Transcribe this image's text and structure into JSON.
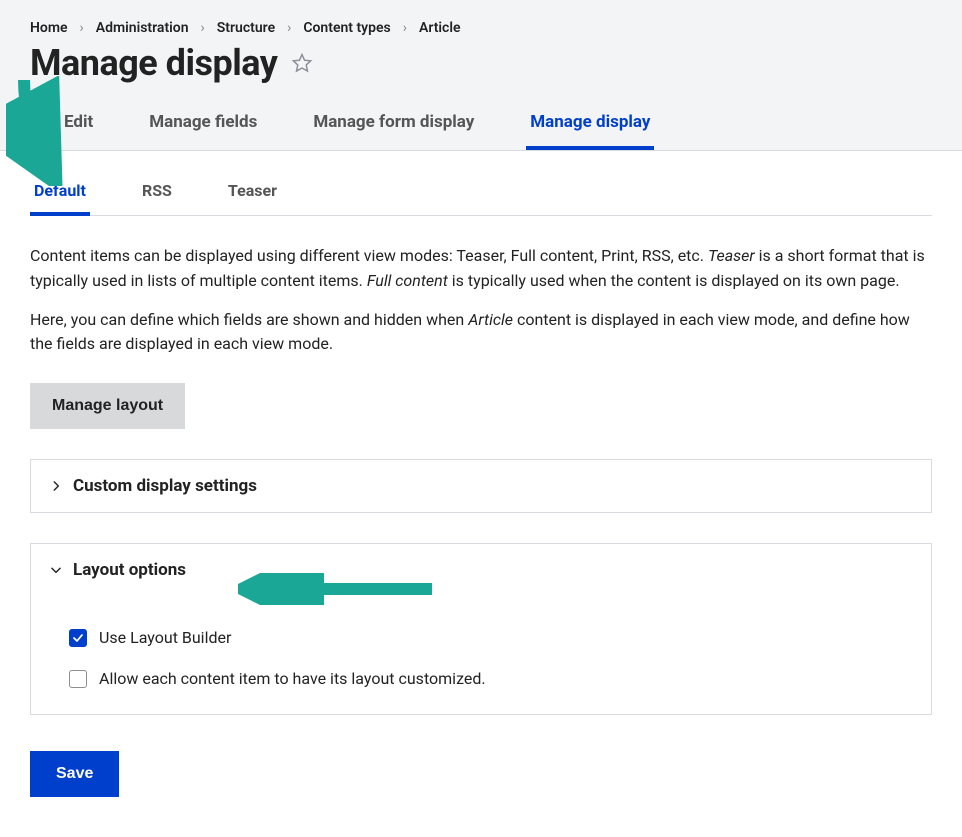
{
  "breadcrumb": [
    "Home",
    "Administration",
    "Structure",
    "Content types",
    "Article"
  ],
  "page_title": "Manage display",
  "primary_tabs": {
    "items": [
      "Edit",
      "Manage fields",
      "Manage form display",
      "Manage display"
    ],
    "active_index": 3
  },
  "secondary_tabs": {
    "items": [
      "Default",
      "RSS",
      "Teaser"
    ],
    "active_index": 0
  },
  "description": {
    "p1_a": "Content items can be displayed using different view modes: Teaser, Full content, Print, RSS, etc. ",
    "p1_teaser": "Teaser",
    "p1_b": " is a short format that is typically used in lists of multiple content items. ",
    "p1_full": "Full content",
    "p1_c": " is typically used when the content is displayed on its own page.",
    "p2_a": "Here, you can define which fields are shown and hidden when ",
    "p2_article": "Article",
    "p2_b": " content is displayed in each view mode, and define how the fields are displayed in each view mode."
  },
  "buttons": {
    "manage_layout": "Manage layout",
    "save": "Save"
  },
  "details": {
    "custom_display": {
      "label": "Custom display settings",
      "open": false
    },
    "layout_options": {
      "label": "Layout options",
      "open": true,
      "use_layout_builder": {
        "label": "Use Layout Builder",
        "checked": true
      },
      "allow_custom": {
        "label": "Allow each content item to have its layout customized.",
        "checked": false
      }
    }
  },
  "colors": {
    "accent": "#003ecc",
    "anno": "#1aa795"
  }
}
